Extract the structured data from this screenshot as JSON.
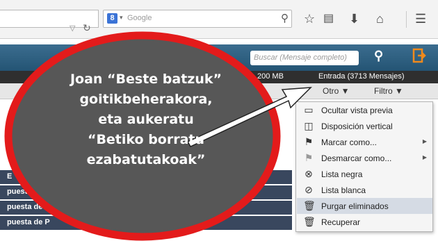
{
  "browser": {
    "search_placeholder": "Google",
    "engine_badge": "8"
  },
  "app": {
    "search_placeholder": "Buscar (Mensaje completo)",
    "quota": "200 MB",
    "folder_info": "Entrada (3713 Mensajes)",
    "toolbar": {
      "otro_label": "Otro ▼",
      "filtro_label": "Filtro ▼"
    }
  },
  "message_rows": [
    {
      "text": "E"
    },
    {
      "text": "puesta"
    },
    {
      "text": "puesta de P"
    },
    {
      "text": "puesta de P"
    }
  ],
  "menu": {
    "items": [
      {
        "label": "Ocultar vista previa",
        "icon": "hide-preview-icon",
        "submenu": false,
        "highlighted": false
      },
      {
        "label": "Disposición vertical",
        "icon": "vertical-layout-icon",
        "submenu": false,
        "highlighted": false
      },
      {
        "label": "Marcar como...",
        "icon": "flag-icon",
        "submenu": true,
        "highlighted": false
      },
      {
        "label": "Desmarcar como...",
        "icon": "flag-gray-icon",
        "submenu": true,
        "highlighted": false
      },
      {
        "label": "Lista negra",
        "icon": "blacklist-icon",
        "submenu": false,
        "highlighted": false
      },
      {
        "label": "Lista blanca",
        "icon": "whitelist-icon",
        "submenu": false,
        "highlighted": false
      },
      {
        "label": "Purgar eliminados",
        "icon": "trash-icon",
        "submenu": false,
        "highlighted": true
      },
      {
        "label": "Recuperar",
        "icon": "trash-icon",
        "submenu": false,
        "highlighted": false
      }
    ]
  },
  "annotation": {
    "line1": "Joan “Beste batzuk”",
    "line2": "goitikbeherakora,",
    "line3": "eta aukeratu",
    "line4": "“Betiko borratu",
    "line5": "ezabatutakoak”",
    "colors": {
      "ring": "#e31b1b",
      "fill": "#575757",
      "text": "#ffffff"
    }
  }
}
